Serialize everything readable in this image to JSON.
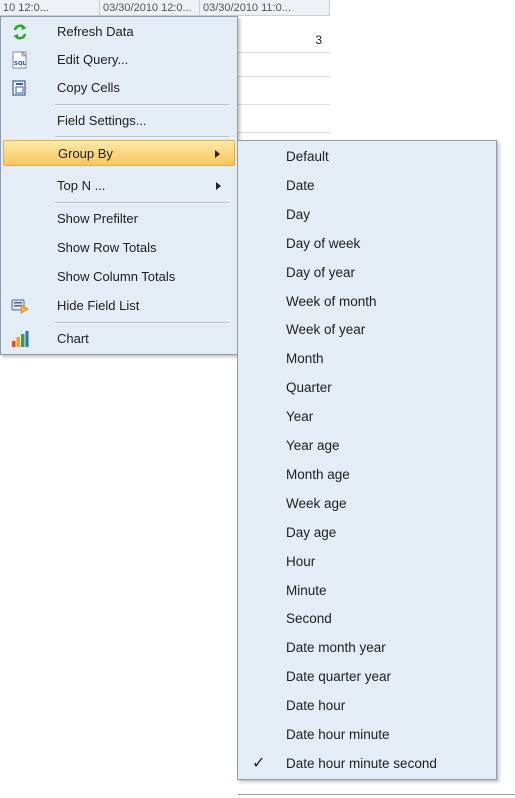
{
  "grid": {
    "headers": [
      "10 12:0...",
      "03/30/2010 12:0...",
      "03/30/2010 11:0..."
    ],
    "rows": [
      {
        "left": "..",
        "value": "3"
      },
      {
        "left": "..",
        "value": ""
      },
      {
        "left": "",
        "value": ""
      },
      {
        "left": "",
        "value": ""
      }
    ]
  },
  "context_menu": {
    "items": [
      {
        "label": "Refresh Data",
        "icon": "refresh-icon"
      },
      {
        "label": "Edit Query...",
        "icon": "sql-icon"
      },
      {
        "label": "Copy Cells",
        "icon": "copy-icon"
      },
      {
        "label": "Field Settings..."
      },
      {
        "label": "Group By",
        "has_submenu": true,
        "selected": true
      },
      {
        "label": "Top N ...",
        "has_submenu": true
      },
      {
        "label": "Show Prefilter"
      },
      {
        "label": "Show Row Totals"
      },
      {
        "label": "Show Column Totals"
      },
      {
        "label": "Hide Field List",
        "icon": "field-list-icon"
      },
      {
        "label": "Chart",
        "icon": "chart-icon"
      }
    ]
  },
  "group_by_menu": {
    "items": [
      {
        "label": "Default"
      },
      {
        "label": "Date"
      },
      {
        "label": "Day"
      },
      {
        "label": "Day of week"
      },
      {
        "label": "Day of year"
      },
      {
        "label": "Week of month"
      },
      {
        "label": "Week of year"
      },
      {
        "label": "Month"
      },
      {
        "label": "Quarter"
      },
      {
        "label": "Year"
      },
      {
        "label": "Year age"
      },
      {
        "label": "Month age"
      },
      {
        "label": "Week age"
      },
      {
        "label": "Day age"
      },
      {
        "label": "Hour"
      },
      {
        "label": "Minute"
      },
      {
        "label": "Second"
      },
      {
        "label": "Date month year"
      },
      {
        "label": "Date quarter year"
      },
      {
        "label": "Date hour"
      },
      {
        "label": "Date hour minute"
      },
      {
        "label": "Date hour minute second",
        "checked": true
      }
    ],
    "check_glyph": "✓"
  },
  "colors": {
    "menu_bg": "#e4ecf5",
    "highlight": "#f7c65c",
    "menu_border": "#8e9bad"
  }
}
